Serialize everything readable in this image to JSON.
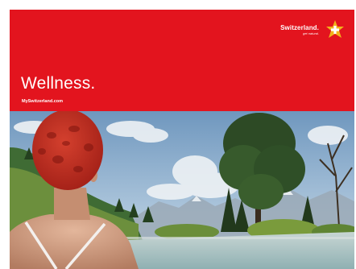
{
  "brand": {
    "name": "Switzerland.",
    "tagline": "get natural.",
    "logo_icon": "swiss-edelweiss-star-logo"
  },
  "headline": "Wellness.",
  "website": "MySwitzerland.com",
  "colors": {
    "brand_red": "#e3141e",
    "text": "#ffffff",
    "logo_yellow": "#f2b21b"
  },
  "photo": {
    "subject": "swimmer-in-red-floral-cap-at-mountain-pool"
  }
}
